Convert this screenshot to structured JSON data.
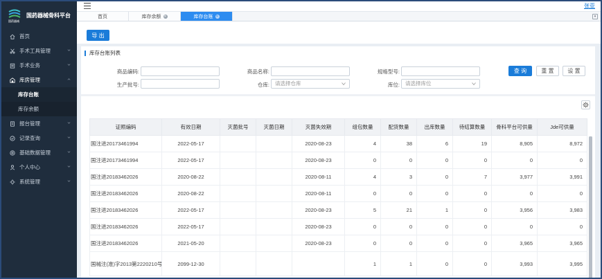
{
  "app": {
    "title": "国药器械骨科平台",
    "logo_caption": "国药器械",
    "user": "张亚"
  },
  "sidebar": {
    "items": [
      {
        "label": "首页",
        "icon": "home-icon",
        "chevron": false
      },
      {
        "label": "手术工具管理",
        "icon": "scissors-icon",
        "chevron": true
      },
      {
        "label": "手术业务",
        "icon": "clipboard-icon",
        "chevron": true
      },
      {
        "label": "库房管理",
        "icon": "warehouse-icon",
        "chevron": true,
        "open": true
      },
      {
        "label": "报台管理",
        "icon": "report-icon",
        "chevron": true
      },
      {
        "label": "记录查询",
        "icon": "check-circle-icon",
        "chevron": true
      },
      {
        "label": "基础数据管理",
        "icon": "settings-circle-icon",
        "chevron": true
      },
      {
        "label": "个人中心",
        "icon": "user-icon",
        "chevron": true
      },
      {
        "label": "系统管理",
        "icon": "gear-icon",
        "chevron": true
      }
    ],
    "sub_items": [
      {
        "label": "库存台账",
        "active": true
      },
      {
        "label": "库存余额",
        "active": false
      }
    ]
  },
  "tabs": [
    {
      "label": "首页",
      "closable": false,
      "active": false
    },
    {
      "label": "库存余额",
      "closable": true,
      "active": false
    },
    {
      "label": "库存台账",
      "closable": true,
      "active": true
    }
  ],
  "toolbar": {
    "export_label": "导 出"
  },
  "panel": {
    "heading": "库存台账列表"
  },
  "filters": {
    "product_code": {
      "label": "商品编码:",
      "value": ""
    },
    "product_name": {
      "label": "商品名称:",
      "value": ""
    },
    "spec_model": {
      "label": "规格型号:",
      "value": ""
    },
    "batch_no": {
      "label": "生产批号:",
      "value": ""
    },
    "warehouse": {
      "label": "仓库:",
      "placeholder": "请选择仓库"
    },
    "location": {
      "label": "库位:",
      "placeholder": "请选择库位"
    },
    "query_label": "查 询",
    "reset_label": "重 置",
    "settings_label": "设 置"
  },
  "table": {
    "columns": [
      "证照编码",
      "有效日期",
      "灭菌批号",
      "灭菌日期",
      "灭菌失效期",
      "组包数量",
      "配货数量",
      "出库数量",
      "待结算数量",
      "骨科平台可供量",
      "Jde可供量"
    ],
    "rows": [
      [
        "国注进20173461994",
        "2022-05-17",
        "",
        "",
        "2020-08-23",
        "4",
        "38",
        "6",
        "19",
        "8,905",
        "8,972"
      ],
      [
        "国注进20173461994",
        "2022-05-17",
        "",
        "",
        "2020-08-23",
        "0",
        "0",
        "0",
        "0",
        "0",
        "0"
      ],
      [
        "国注进20183462026",
        "2020-08-22",
        "",
        "",
        "2020-08-11",
        "4",
        "3",
        "0",
        "7",
        "3,977",
        "3,991"
      ],
      [
        "国注进20183462026",
        "2020-08-22",
        "",
        "",
        "2020-08-11",
        "0",
        "0",
        "0",
        "0",
        "0",
        "0"
      ],
      [
        "国注进20183462026",
        "2022-05-17",
        "",
        "",
        "2020-08-23",
        "5",
        "21",
        "1",
        "0",
        "3,956",
        "3,983"
      ],
      [
        "国注进20183462026",
        "2022-05-17",
        "",
        "",
        "2020-08-23",
        "0",
        "0",
        "0",
        "0",
        "0",
        "0"
      ],
      [
        "国注进20183462026",
        "2021-05-20",
        "",
        "",
        "2020-08-23",
        "0",
        "0",
        "0",
        "0",
        "3,965",
        "3,965"
      ],
      [
        "国械注(准)字2013第2220210号",
        "2099-12-30",
        "",
        "",
        "",
        "1",
        "1",
        "0",
        "0",
        "3,993",
        "3,995"
      ]
    ]
  },
  "colors": {
    "sidebar_bg": "#1f2d3d",
    "accent": "#1a7cd9",
    "tab_active": "#2d8cf0"
  }
}
